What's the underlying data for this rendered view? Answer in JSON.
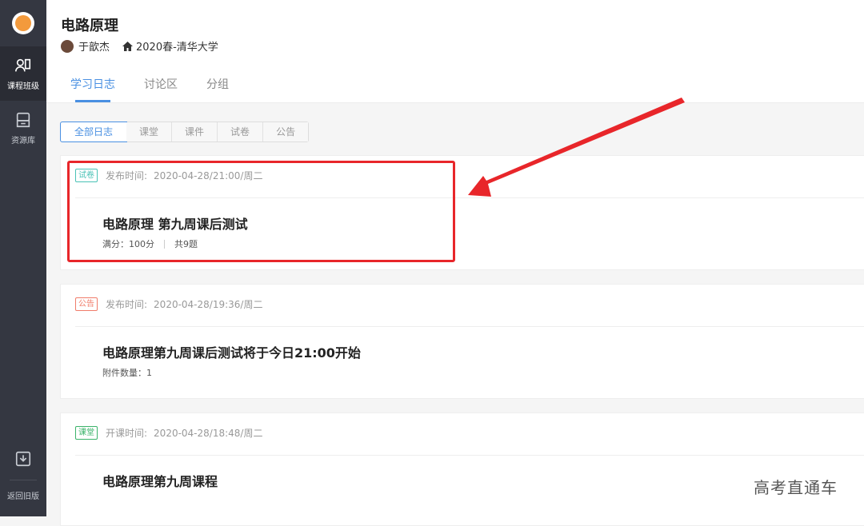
{
  "sidebar": {
    "items": [
      {
        "label": "课程班级",
        "icon": "class-icon"
      },
      {
        "label": "资源库",
        "icon": "library-icon"
      }
    ],
    "bottom": {
      "label": "返回旧版",
      "icon": "download-icon"
    }
  },
  "header": {
    "title": "电路原理",
    "teacher": "于歆杰",
    "term": "2020春-清华大学",
    "tabs": [
      "学习日志",
      "讨论区",
      "分组"
    ]
  },
  "filters": [
    "全部日志",
    "课堂",
    "课件",
    "试卷",
    "公告"
  ],
  "logs": [
    {
      "badge": "试卷",
      "time_label": "发布时间:",
      "time": "2020-04-28/21:00/周二",
      "title": "电路原理 第九周课后测试",
      "sub1": "满分：100分",
      "sub2": "共9题"
    },
    {
      "badge": "公告",
      "time_label": "发布时间:",
      "time": "2020-04-28/19:36/周二",
      "title": "电路原理第九周课后测试将于今日21:00开始",
      "sub1": "附件数量：1"
    },
    {
      "badge": "课堂",
      "time_label": "开课时间:",
      "time": "2020-04-28/18:48/周二",
      "title": "电路原理第九周课程"
    }
  ],
  "watermark": "高考直通车",
  "colors": {
    "accent": "#4a90e2",
    "sidebar": "#343741",
    "highlight": "#e8262a",
    "arrow": "#e8262a"
  }
}
